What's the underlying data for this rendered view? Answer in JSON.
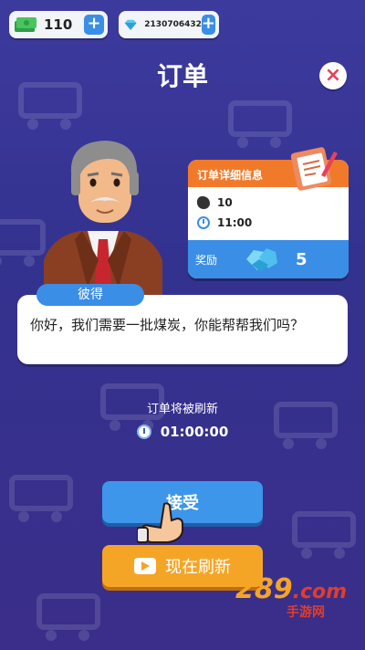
{
  "resources": {
    "cash": {
      "value": "110",
      "icon": "cash-icon"
    },
    "gems": {
      "value": "2130706432",
      "icon": "gem-icon"
    }
  },
  "title": "订单",
  "order_card": {
    "header": "订单详细信息",
    "coal_amount": "10",
    "time": "11:00",
    "reward_label": "奖励",
    "reward_value": "5"
  },
  "npc": {
    "name": "彼得",
    "message": "你好，我们需要一批煤炭，你能帮帮我们吗？"
  },
  "refresh": {
    "label": "订单将被刷新",
    "countdown": "01:00:00"
  },
  "buttons": {
    "accept": "接受",
    "refresh_now": "现在刷新"
  },
  "watermark": {
    "brand": "289",
    "domain": ".com",
    "sub": "手游网"
  },
  "colors": {
    "background": "#3d3a9e",
    "accent_blue": "#3d96ea",
    "accent_orange": "#f07a2a",
    "refresh_button": "#f5a526",
    "close_red": "#e8415b"
  }
}
